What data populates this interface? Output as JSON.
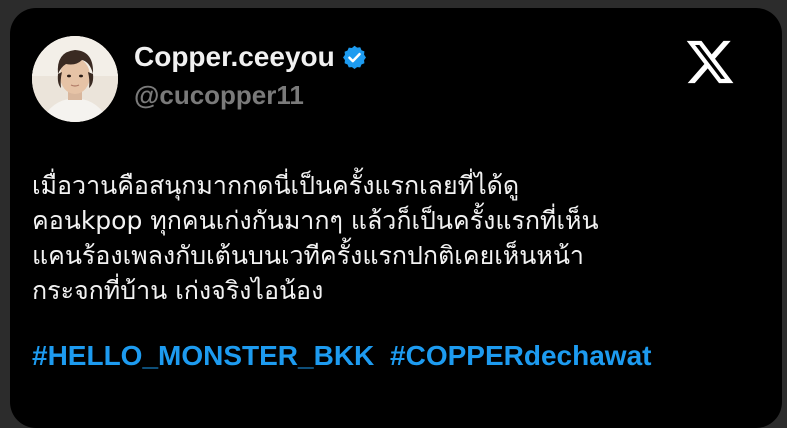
{
  "post": {
    "author": {
      "display_name": "Copper.ceeyou",
      "handle": "@cucopper11",
      "verified": true,
      "avatar_icon": "profile-photo"
    },
    "platform_icon": "x-logo",
    "text_lines": [
      "เมื่อวานคือสนุกมากกดนี่เป็นครั้งแรกเลยที่ได้ดู",
      "คอนkpop ทุกคนเก่งกันมากๆ แล้วก็เป็นครั้งแรกที่เห็น",
      "แคนร้องเพลงกับเต้นบนเวทีครั้งแรกปกติเคยเห็นหน้า",
      "กระจกที่บ้าน เก่งจริงไอน้อง"
    ],
    "hashtags": [
      "#HELLO_MONSTER_BKK",
      "#COPPERdechawat"
    ]
  },
  "colors": {
    "background": "#000000",
    "name_text": "#f1f1f1",
    "handle_text": "#7a7a7a",
    "hashtag": "#1d9bf0",
    "verified_badge": "#1d9bf0"
  }
}
